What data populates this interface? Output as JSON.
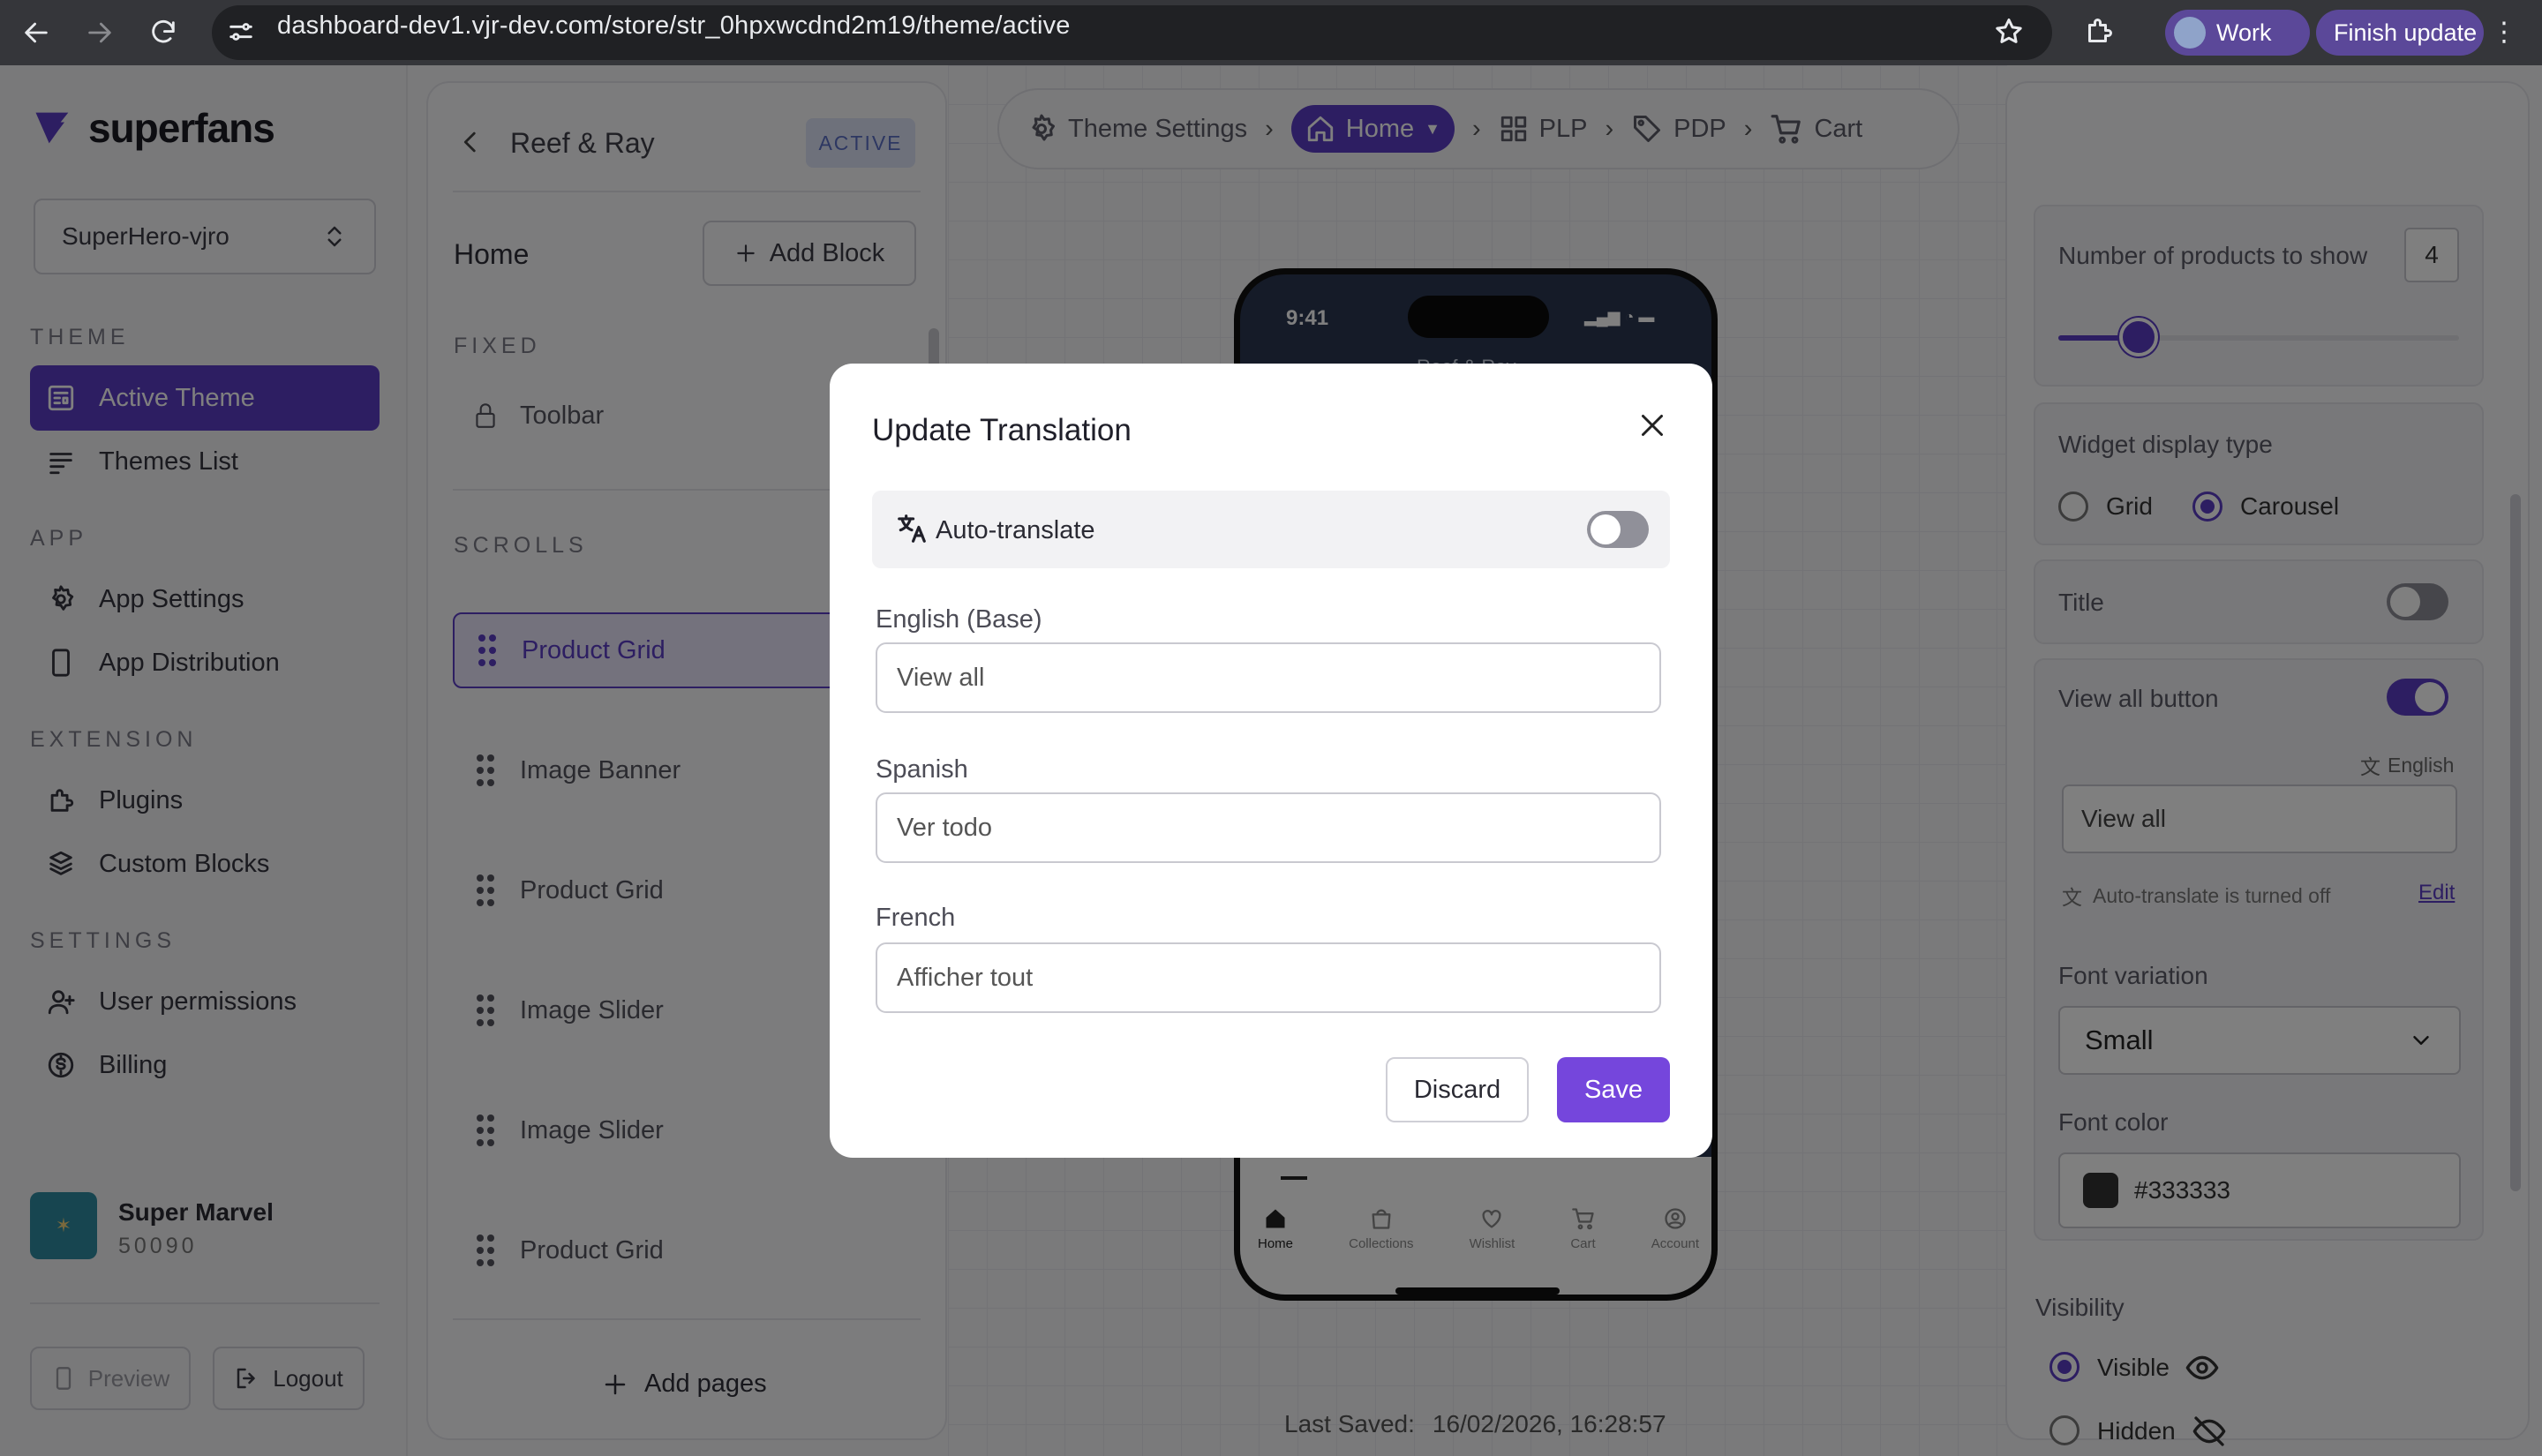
{
  "browser": {
    "url": "dashboard-dev1.vjr-dev.com/store/str_0hpxwcdnd2m19/theme/active",
    "profile_label": "Work",
    "update_label": "Finish update"
  },
  "sidebar": {
    "brand": "superfans",
    "store_selector": "SuperHero-vjro",
    "sections": {
      "theme": "THEME",
      "app": "APP",
      "extension": "EXTENSION",
      "settings": "SETTINGS"
    },
    "items": {
      "active_theme": "Active Theme",
      "themes_list": "Themes List",
      "app_settings": "App Settings",
      "app_distribution": "App Distribution",
      "plugins": "Plugins",
      "custom_blocks": "Custom Blocks",
      "user_permissions": "User permissions",
      "billing": "Billing"
    },
    "user": {
      "name": "Super Marvel",
      "id": "50090"
    },
    "preview_label": "Preview",
    "logout_label": "Logout"
  },
  "block_panel": {
    "theme_name": "Reef & Ray",
    "status_badge": "ACTIVE",
    "page_title": "Home",
    "add_block_label": "Add Block",
    "fixed_label": "FIXED",
    "toolbar_label": "Toolbar",
    "scrolls_label": "SCROLLS",
    "blocks": [
      "Product Grid",
      "Image Banner",
      "Product Grid",
      "Image Slider",
      "Image Slider",
      "Product Grid"
    ],
    "add_pages_label": "Add pages"
  },
  "breadcrumb": {
    "items": [
      "Theme Settings",
      "Home",
      "PLP",
      "PDP",
      "Cart"
    ]
  },
  "phone": {
    "time": "9:41",
    "app_title": "Reef & Ray",
    "tabs": [
      "Home",
      "Collections",
      "Wishlist",
      "Cart",
      "Account"
    ]
  },
  "last_saved": {
    "label": "Last Saved:",
    "value": "16/02/2026, 16:28:57"
  },
  "settings_panel": {
    "num_products_label": "Number of products to show",
    "num_products_value": "4",
    "num_products_slider_fraction": 0.2,
    "widget_type_label": "Widget display type",
    "widget_options": [
      "Grid",
      "Carousel"
    ],
    "widget_selected": "Carousel",
    "title_label": "Title",
    "view_all_label": "View all button",
    "language_label": "English",
    "view_all_value": "View all",
    "auto_translate_note": "Auto-translate is turned off",
    "edit_label": "Edit",
    "font_variation_label": "Font variation",
    "font_variation_value": "Small",
    "font_color_label": "Font color",
    "font_color_value": "#333333",
    "visibility_label": "Visibility",
    "visible_label": "Visible",
    "hidden_label": "Hidden"
  },
  "modal": {
    "title": "Update Translation",
    "auto_translate_label": "Auto-translate",
    "fields": [
      {
        "label": "English (Base)",
        "value": "View all"
      },
      {
        "label": "Spanish",
        "value": "Ver todo"
      },
      {
        "label": "French",
        "value": "Afficher tout"
      }
    ],
    "discard_label": "Discard",
    "save_label": "Save"
  },
  "colors": {
    "accent": "#5b3cc4",
    "chrome": "#35363a"
  }
}
